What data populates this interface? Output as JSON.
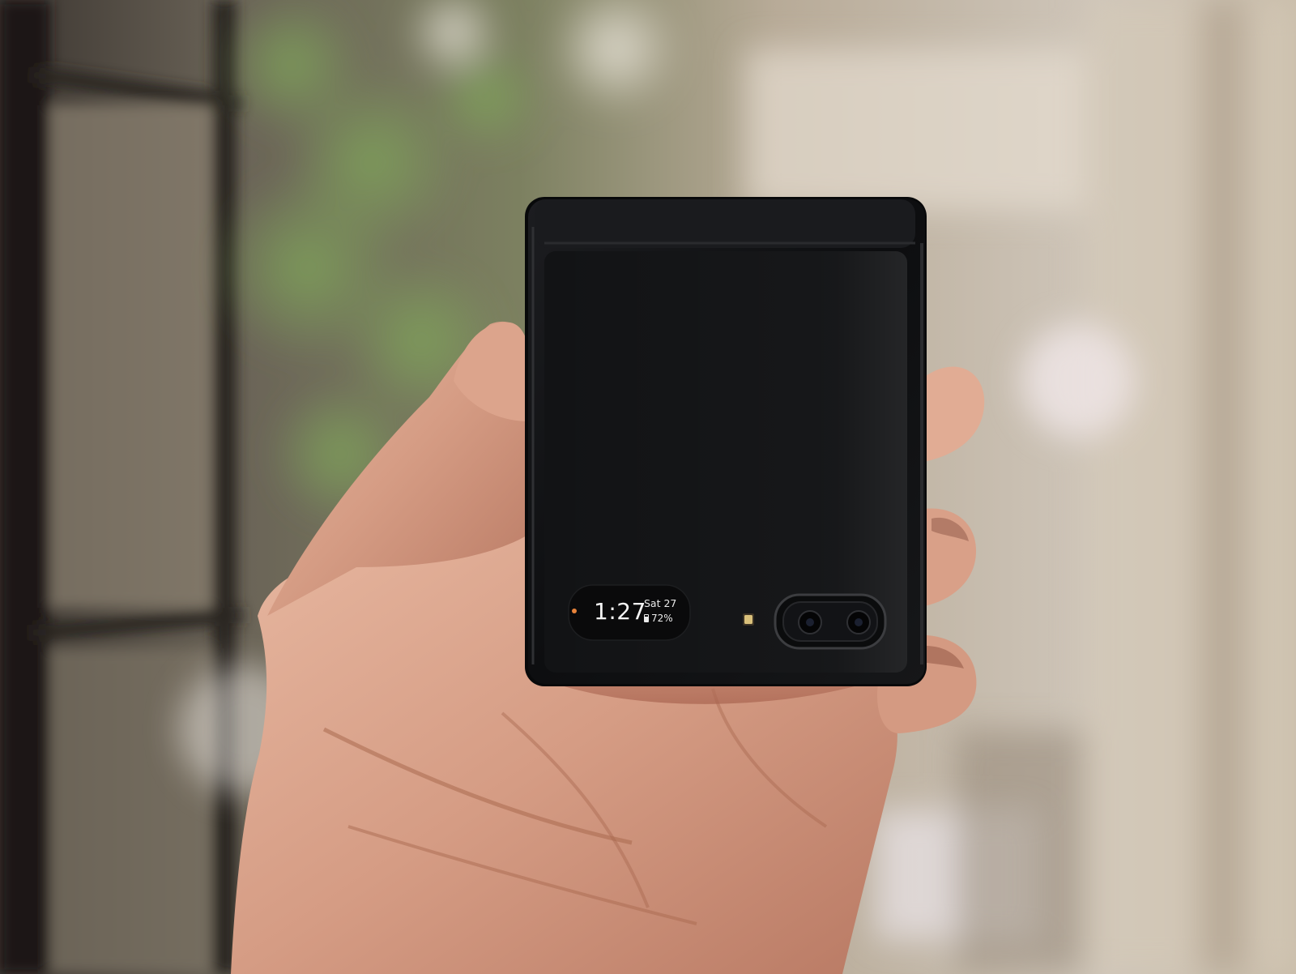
{
  "cover_screen": {
    "time": "1:27",
    "date": "Sat 27",
    "battery": "72%",
    "battery_level": 0.72
  },
  "icons": {
    "notification": "notification-dot-icon",
    "battery": "battery-icon",
    "flash": "flash-icon",
    "camera": "dual-camera-icon"
  },
  "colors": {
    "phone_body": "#111214",
    "notification_dot": "#e8833a",
    "skin": "#d9a58c"
  }
}
